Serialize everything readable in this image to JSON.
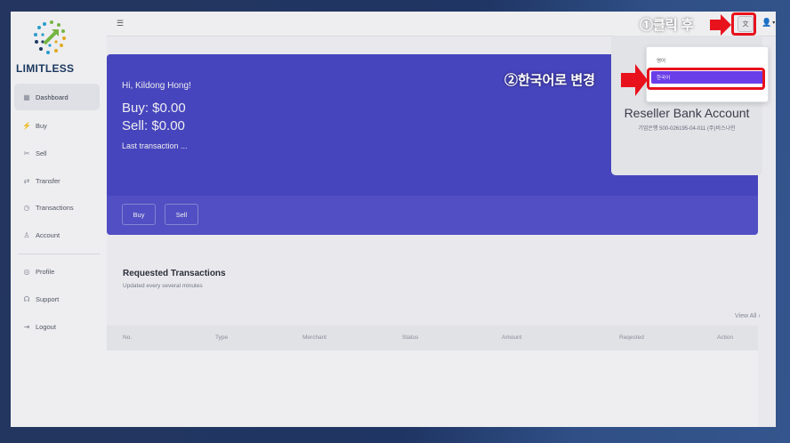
{
  "sidebar": {
    "logo_text": "LIMITLESS",
    "items": [
      {
        "label": "Dashboard",
        "icon": "dashboard-icon",
        "active": true
      },
      {
        "label": "Buy",
        "icon": "buy-icon"
      },
      {
        "label": "Sell",
        "icon": "sell-icon"
      },
      {
        "label": "Transfer",
        "icon": "transfer-icon"
      },
      {
        "label": "Transactions",
        "icon": "clock-icon"
      },
      {
        "label": "Account",
        "icon": "user-icon"
      },
      {
        "label": "Profile",
        "icon": "profile-icon"
      },
      {
        "label": "Support",
        "icon": "support-icon"
      },
      {
        "label": "Logout",
        "icon": "logout-icon"
      }
    ]
  },
  "hero": {
    "greeting": "Hi, Kildong Hong!",
    "buy": "Buy: $0.00",
    "sell": "Sell: $0.00",
    "last_transaction": "Last transaction ...",
    "buy_button": "Buy",
    "sell_button": "Sell"
  },
  "bank_card": {
    "title": "Reseller Bank Account",
    "subtitle": "기업은행 500-026195-04-011 (주)비스나인"
  },
  "requested": {
    "title": "Requested Transactions",
    "subtitle": "Updated every several minutes",
    "view_all": "View All",
    "columns": [
      "No.",
      "Type",
      "Merchant",
      "Status",
      "Amount",
      "Reqested",
      "Action"
    ]
  },
  "language_menu": {
    "options": [
      "영어",
      "한국어"
    ],
    "selected": "한국어"
  },
  "annotations": {
    "step1": "①클릭 후",
    "step2": "②한국어로 변경"
  },
  "colors": {
    "hero": "#4a48c8",
    "accent": "#6a3ee8",
    "annotation_red": "#e8121c"
  }
}
